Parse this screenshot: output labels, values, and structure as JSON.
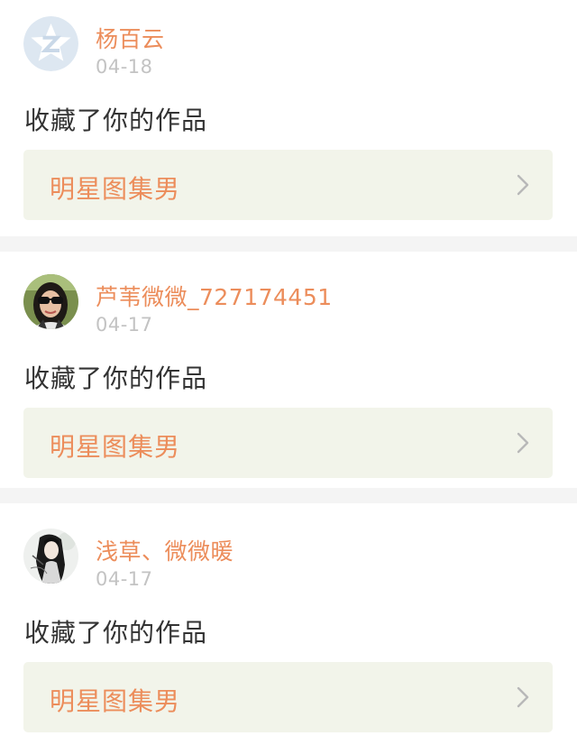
{
  "notifications": [
    {
      "username": "杨百云",
      "date": "04-18",
      "action": "收藏了你的作品",
      "work_title": "明星图集男",
      "avatar_icon": "default-avatar-icon"
    },
    {
      "username": "芦苇微微_727174451",
      "date": "04-17",
      "action": "收藏了你的作品",
      "work_title": "明星图集男",
      "avatar_icon": "user-photo-sunglasses"
    },
    {
      "username": "浅草、微微暖",
      "date": "04-17",
      "action": "收藏了你的作品",
      "work_title": "明星图集男",
      "avatar_icon": "user-photo-anime"
    }
  ],
  "colors": {
    "accent": "#ec8d5b",
    "date": "#c3c3c3",
    "text": "#333333",
    "work_box_bg": "#f2f4ea",
    "separator": "#f4f4f4"
  }
}
